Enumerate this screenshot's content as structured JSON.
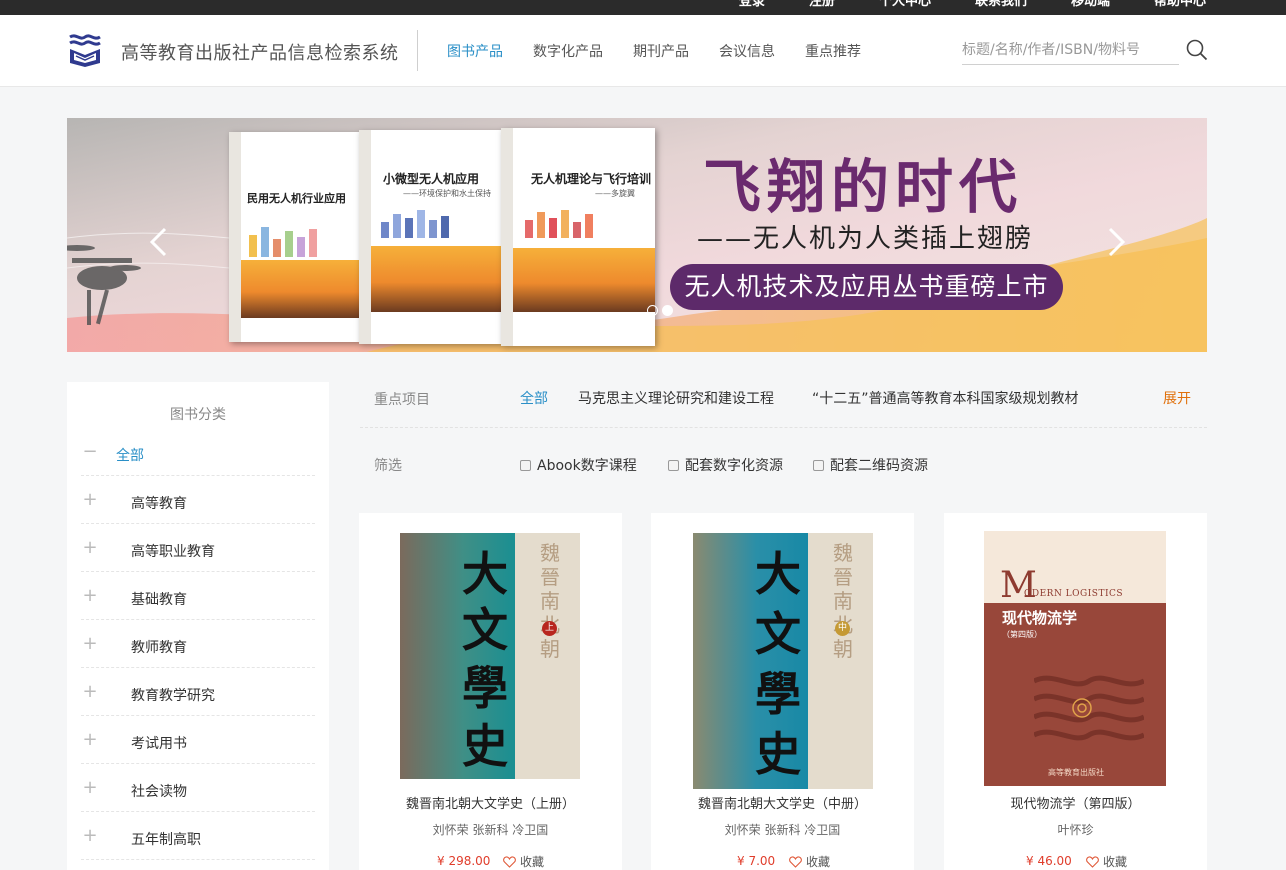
{
  "top_links": [
    "登录",
    "注册",
    "个人中心",
    "联系我们",
    "移动端",
    "帮助中心"
  ],
  "header": {
    "title": "高等教育出版社产品信息检索系统",
    "nav": [
      {
        "label": "图书产品",
        "active": true
      },
      {
        "label": "数字化产品",
        "active": false
      },
      {
        "label": "期刊产品",
        "active": false
      },
      {
        "label": "会议信息",
        "active": false
      },
      {
        "label": "重点推荐",
        "active": false
      }
    ],
    "search_placeholder": "标题/名称/作者/ISBN/物料号"
  },
  "banner": {
    "headline": "飞翔的时代",
    "subline": "——无人机为人类插上翅膀",
    "pill": "无人机技术及应用丛书重磅上市",
    "books": [
      {
        "title": "民用无人机行业应用",
        "sub": ""
      },
      {
        "title": "小微型无人机应用",
        "sub": "——环境保护和水土保持"
      },
      {
        "title": "无人机理论与飞行培训",
        "sub": "——多旋翼"
      }
    ],
    "slide_count": 2,
    "active_slide": 2
  },
  "sidebar": {
    "title": "图书分类",
    "items": [
      {
        "label": "全部",
        "symbol": "−"
      },
      {
        "label": "高等教育",
        "symbol": "+"
      },
      {
        "label": "高等职业教育",
        "symbol": "+"
      },
      {
        "label": "基础教育",
        "symbol": "+"
      },
      {
        "label": "教师教育",
        "symbol": "+"
      },
      {
        "label": "教育教学研究",
        "symbol": "+"
      },
      {
        "label": "考试用书",
        "symbol": "+"
      },
      {
        "label": "社会读物",
        "symbol": "+"
      },
      {
        "label": "五年制高职",
        "symbol": "+"
      }
    ]
  },
  "filters": {
    "projects_label": "重点项目",
    "projects": [
      "全部",
      "马克思主义理论研究和建设工程",
      "“十二五”普通高等教育本科国家级规划教材"
    ],
    "expand_label": "展开",
    "screen_label": "筛选",
    "checkboxes": [
      "Abook数字课程",
      "配套数字化资源",
      "配套二维码资源"
    ]
  },
  "products": [
    {
      "name": "魏晋南北朝大文学史（上册）",
      "author": "刘怀荣 张新科 冷卫国",
      "price": "¥ 298.00",
      "fav_label": "收藏",
      "cover_big": [
        "大",
        "文",
        "學",
        "史"
      ],
      "cover_small": "魏晉南北朝",
      "cover_seal": "上"
    },
    {
      "name": "魏晋南北朝大文学史（中册）",
      "author": "刘怀荣 张新科 冷卫国",
      "price": "¥ 7.00",
      "fav_label": "收藏",
      "cover_big": [
        "大",
        "文",
        "學",
        "史"
      ],
      "cover_small": "魏晉南北朝",
      "cover_seal": "中"
    },
    {
      "name": "现代物流学（第四版）",
      "author": "叶怀珍",
      "price": "¥ 46.00",
      "fav_label": "收藏",
      "cover_m": "M",
      "cover_en": "ODERN LOGISTICS",
      "cover_cn": "现代物流学",
      "cover_ed": "（第四版）",
      "cover_pub": "高等教育出版社"
    }
  ],
  "colors": {
    "accent": "#2a8fc7",
    "price": "#e03d2b",
    "expand": "#e0700a",
    "banner_purple": "#5d2a6a"
  }
}
